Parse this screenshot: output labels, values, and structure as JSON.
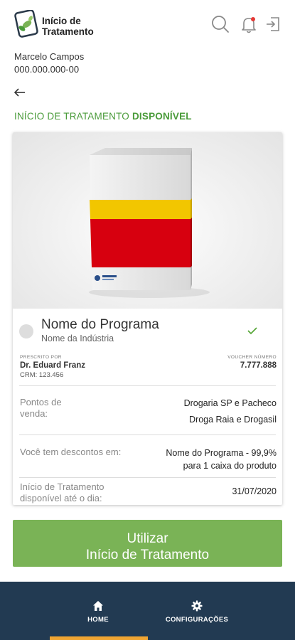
{
  "header": {
    "app_title_line1": "Início de",
    "app_title_line2": "Tratamento",
    "icons": [
      "search-icon",
      "bell-icon",
      "logout-icon"
    ],
    "notification_dot_color": "#e53935"
  },
  "user": {
    "name": "Marcelo Campos",
    "document": "000.000.000-00"
  },
  "status": {
    "prefix": "INÍCIO DE TRATAMENTO ",
    "value": "DISPONÍVEL"
  },
  "program": {
    "name": "Nome do Programa",
    "industry": "Nome da Indústria",
    "prescribed_by_label": "PRESCRITO POR",
    "doctor": "Dr. Eduard Franz",
    "crm": "CRM: 123.456",
    "voucher_label": "VOUCHER NÚMERO",
    "voucher_number": "7.777.888",
    "sale_points_label": "Pontos de venda:",
    "sale_points": [
      "Drogaria SP e Pacheco",
      "Droga Raia e Drogasil"
    ],
    "discount_label": "Você tem descontos em:",
    "discount_line1": "Nome do Programa - 99,9%",
    "discount_line2": "para 1 caixa do produto",
    "available_until_label": "Início de Tratamento disponível até o dia:",
    "available_until": "31/07/2020"
  },
  "action": {
    "line1": "Utilizar",
    "line2": "Início de Tratamento"
  },
  "nav": {
    "items": [
      {
        "label": "HOME",
        "icon": "home-icon",
        "active": true
      },
      {
        "label": "CONFIGURAÇÕES",
        "icon": "gear-icon",
        "active": false
      }
    ]
  },
  "colors": {
    "accent_green": "#4a9b3a",
    "button_green": "#7ab356",
    "nav_bg": "#223a52",
    "nav_active": "#f0a532"
  }
}
